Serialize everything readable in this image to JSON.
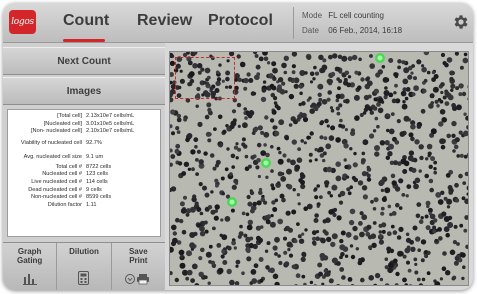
{
  "app": {
    "logo_text": "logos",
    "tabs": [
      {
        "label": "Count",
        "active": true
      },
      {
        "label": "Review",
        "active": false
      },
      {
        "label": "Protocol",
        "active": false
      }
    ],
    "info": {
      "mode_key": "Mode",
      "mode_value": "FL cell counting",
      "date_key": "Date",
      "date_value": "06 Feb., 2014, 16:18"
    },
    "settings_icon": "gear-icon",
    "accent_color": "#d3262b"
  },
  "sidebar": {
    "next_count_label": "Next Count",
    "images_label": "Images",
    "results": [
      {
        "label": "[Total cell]",
        "value": "2.13x10e7 cells/mL"
      },
      {
        "label": "[Nucleated cell]",
        "value": "3.01x10e5 cells/mL"
      },
      {
        "label": "[Non- nucleated cell]",
        "value": "2.10x10e7 cells/mL"
      },
      {
        "label": "Viability of nucleated cell",
        "value": "92.7%"
      },
      {
        "label": "Avg. nucleated cell size",
        "value": "9.1 um"
      },
      {
        "label": "Total cell #",
        "value": "8722 cells"
      },
      {
        "label": "Nucleated cell #",
        "value": "123 cells"
      },
      {
        "label": "Live nucleated cell #",
        "value": "114 cells"
      },
      {
        "label": "Dead nucleated cell #",
        "value": "9 cells"
      },
      {
        "label": "Non-nucleated cell #",
        "value": "8599 cells"
      },
      {
        "label": "Dilution factor",
        "value": "1.11"
      }
    ],
    "tools": [
      {
        "label_line1": "Graph",
        "label_line2": "Gating",
        "icon": "bar-chart-icon"
      },
      {
        "label_line1": "Dilution",
        "label_line2": "",
        "icon": "calculator-icon"
      },
      {
        "label_line1": "Save",
        "label_line2": "Print",
        "icon": "save-print-icon"
      }
    ]
  }
}
